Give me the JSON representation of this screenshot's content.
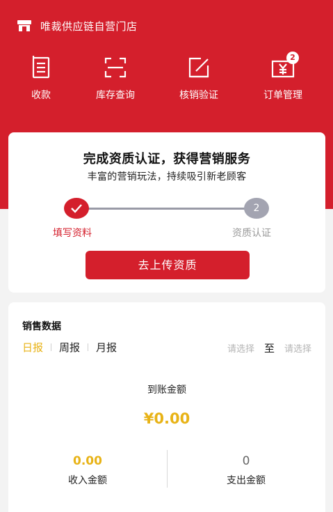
{
  "header": {
    "store_name": "唯裁供应链自营门店",
    "store_icon": "store-icon"
  },
  "quick_nav": [
    {
      "label": "收款",
      "icon": "receipt-icon"
    },
    {
      "label": "库存查询",
      "icon": "scan-icon"
    },
    {
      "label": "核销验证",
      "icon": "edit-verify-icon"
    },
    {
      "label": "订单管理",
      "icon": "order-yen-icon",
      "badge": "2"
    }
  ],
  "qualification": {
    "title": "完成资质认证，获得营销服务",
    "subtitle": "丰富的营销玩法，持续吸引新老顾客",
    "steps": [
      {
        "label": "填写资料",
        "status": "done"
      },
      {
        "label": "资质认证",
        "number": "2",
        "status": "todo"
      }
    ],
    "button_label": "去上传资质"
  },
  "sales": {
    "title": "销售数据",
    "tabs": [
      {
        "label": "日报",
        "active": true
      },
      {
        "label": "周报",
        "active": false
      },
      {
        "label": "月报",
        "active": false
      }
    ],
    "date_from_placeholder": "请选择",
    "date_to_label": "至",
    "date_to_placeholder": "请选择",
    "arrival_label": "到账金额",
    "arrival_amount": "¥0.00",
    "income": {
      "value": "0.00",
      "label": "收入金额"
    },
    "expense": {
      "value": "0",
      "label": "支出金额"
    }
  },
  "colors": {
    "brand_red": "#d41f2c",
    "accent_yellow": "#e8b317",
    "inactive_gray": "#a3a4b1"
  }
}
